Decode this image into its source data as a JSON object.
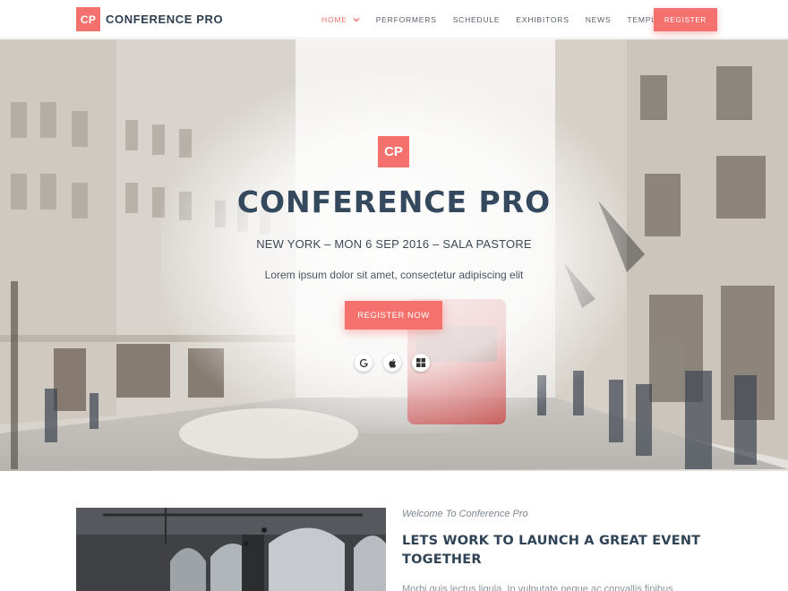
{
  "brand": {
    "logo_text": "CP",
    "name": "CONFERENCE PRO"
  },
  "nav": {
    "items": [
      {
        "label": "HOME",
        "active": true
      },
      {
        "label": "PERFORMERS",
        "active": false
      },
      {
        "label": "SCHEDULE",
        "active": false
      },
      {
        "label": "EXHIBITORS",
        "active": false
      },
      {
        "label": "NEWS",
        "active": false
      },
      {
        "label": "TEMPLATES",
        "active": false
      }
    ],
    "register_label": "REGISTER"
  },
  "hero": {
    "logo_text": "CP",
    "title": "CONFERENCE PRO",
    "subtitle": "NEW YORK – MON 6 SEP 2016 – SALA PASTORE",
    "description": "Lorem ipsum dolor sit amet, consectetur adipiscing elit",
    "cta_label": "REGISTER NOW",
    "store_icons": [
      "google-play-icon",
      "apple-icon",
      "windows-icon"
    ]
  },
  "intro": {
    "eyebrow": "Welcome To Conference Pro",
    "heading": "LETS WORK TO LAUNCH A GREAT EVENT TOGETHER",
    "body": "Morbi quis lectus ligula. In vulputate neque ac convallis finibus"
  },
  "colors": {
    "accent": "#f5716e",
    "heading": "#34495e"
  }
}
